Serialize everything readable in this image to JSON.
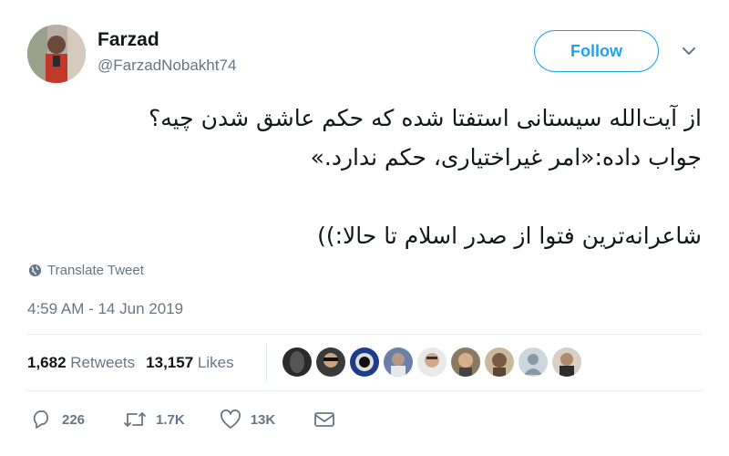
{
  "author": {
    "name": "Farzad",
    "handle": "@FarzadNobakht74"
  },
  "follow_label": "Follow",
  "tweet": {
    "lines": [
      "از آیت‌الله سیستانی استفتا شده که حکم عاشق شدن چیه؟",
      "جواب داده:«امر غیراختیاری، حکم ندارد.»",
      "شاعرانه‌ترین فتوا از صدر اسلام تا حالا:))"
    ]
  },
  "translate_label": "Translate Tweet",
  "timestamp": "4:59 AM - 14 Jun 2019",
  "stats": {
    "retweets_count": "1,682",
    "retweets_label": "Retweets",
    "likes_count": "13,157",
    "likes_label": "Likes"
  },
  "actions": {
    "replies": "226",
    "retweets": "1.7K",
    "likes": "13K"
  },
  "colors": {
    "accent": "#1da1f2",
    "secondary_text": "#657786",
    "divider": "#e6ecf0"
  },
  "icons": [
    "globe-icon",
    "caret-down-icon",
    "reply-icon",
    "retweet-icon",
    "heart-icon",
    "message-icon"
  ]
}
